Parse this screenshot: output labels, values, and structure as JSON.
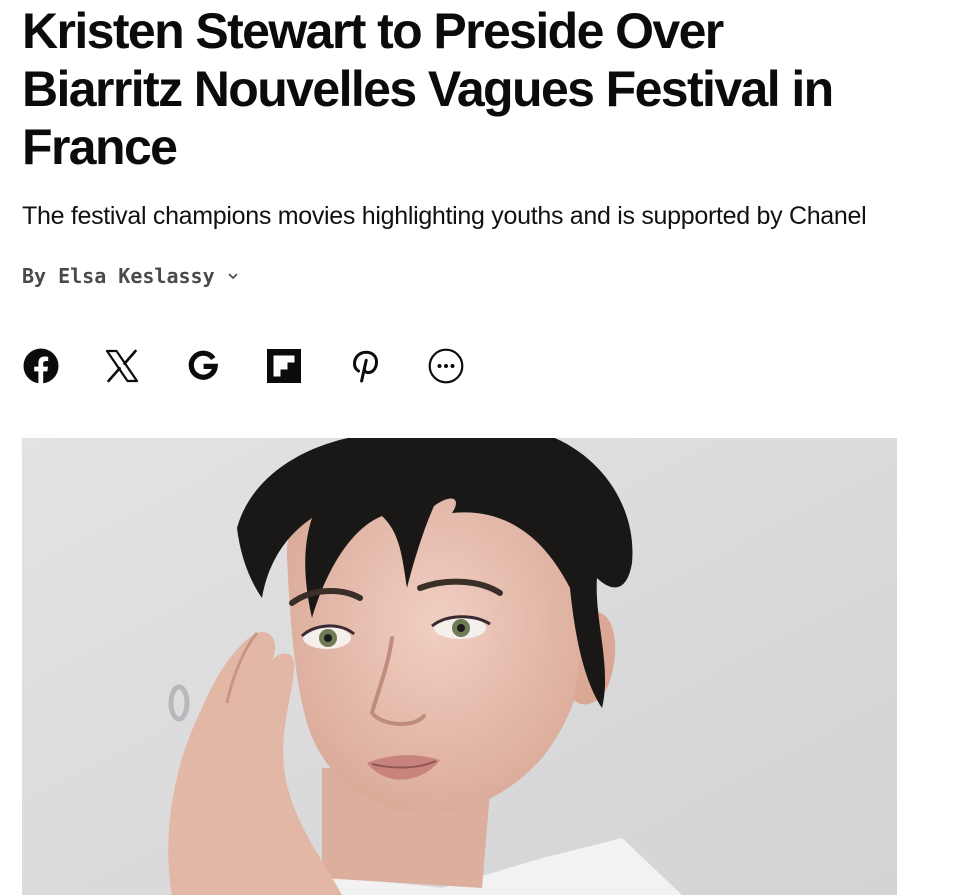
{
  "article": {
    "headline": "Kristen Stewart to Preside Over Biarritz Nouvelles Vagues Festival in France",
    "dek": "The festival champions movies highlighting youths and is supported by Chanel",
    "byline": {
      "prefix": "By",
      "author": "Elsa Keslassy"
    }
  },
  "share": {
    "buttons": [
      {
        "icon": "facebook-icon"
      },
      {
        "icon": "x-icon"
      },
      {
        "icon": "google-icon"
      },
      {
        "icon": "flipboard-icon"
      },
      {
        "icon": "pinterest-icon"
      },
      {
        "icon": "more-icon"
      }
    ]
  },
  "colors": {
    "text": "#0b0b0b",
    "byline": "#4a4a4a",
    "hero_background": "#dcdcdd",
    "hair": "#1a1816",
    "skin": "#e9c1b3"
  }
}
